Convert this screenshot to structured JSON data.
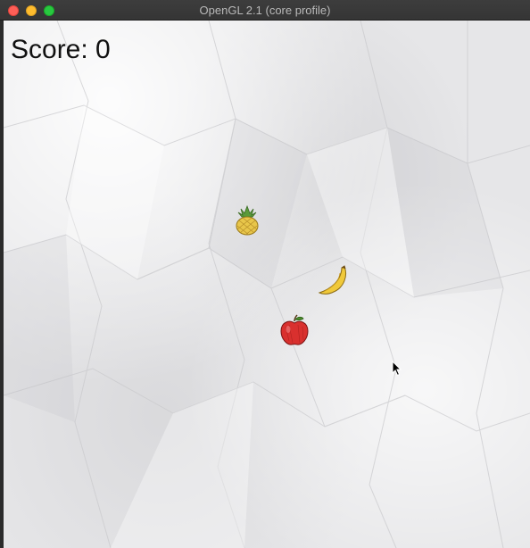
{
  "window": {
    "title": "OpenGL 2.1 (core profile)"
  },
  "hud": {
    "score_label": "Score: 0"
  },
  "fruits": [
    {
      "kind": "pineapple",
      "icon": "pineapple-icon"
    },
    {
      "kind": "banana",
      "icon": "banana-icon"
    },
    {
      "kind": "apple",
      "icon": "apple-icon"
    }
  ],
  "colors": {
    "background_paper": "#e6e6e8",
    "score_text": "#111111",
    "pineapple": "#e8c64a",
    "banana": "#f0c93a",
    "apple": "#d9302e"
  }
}
